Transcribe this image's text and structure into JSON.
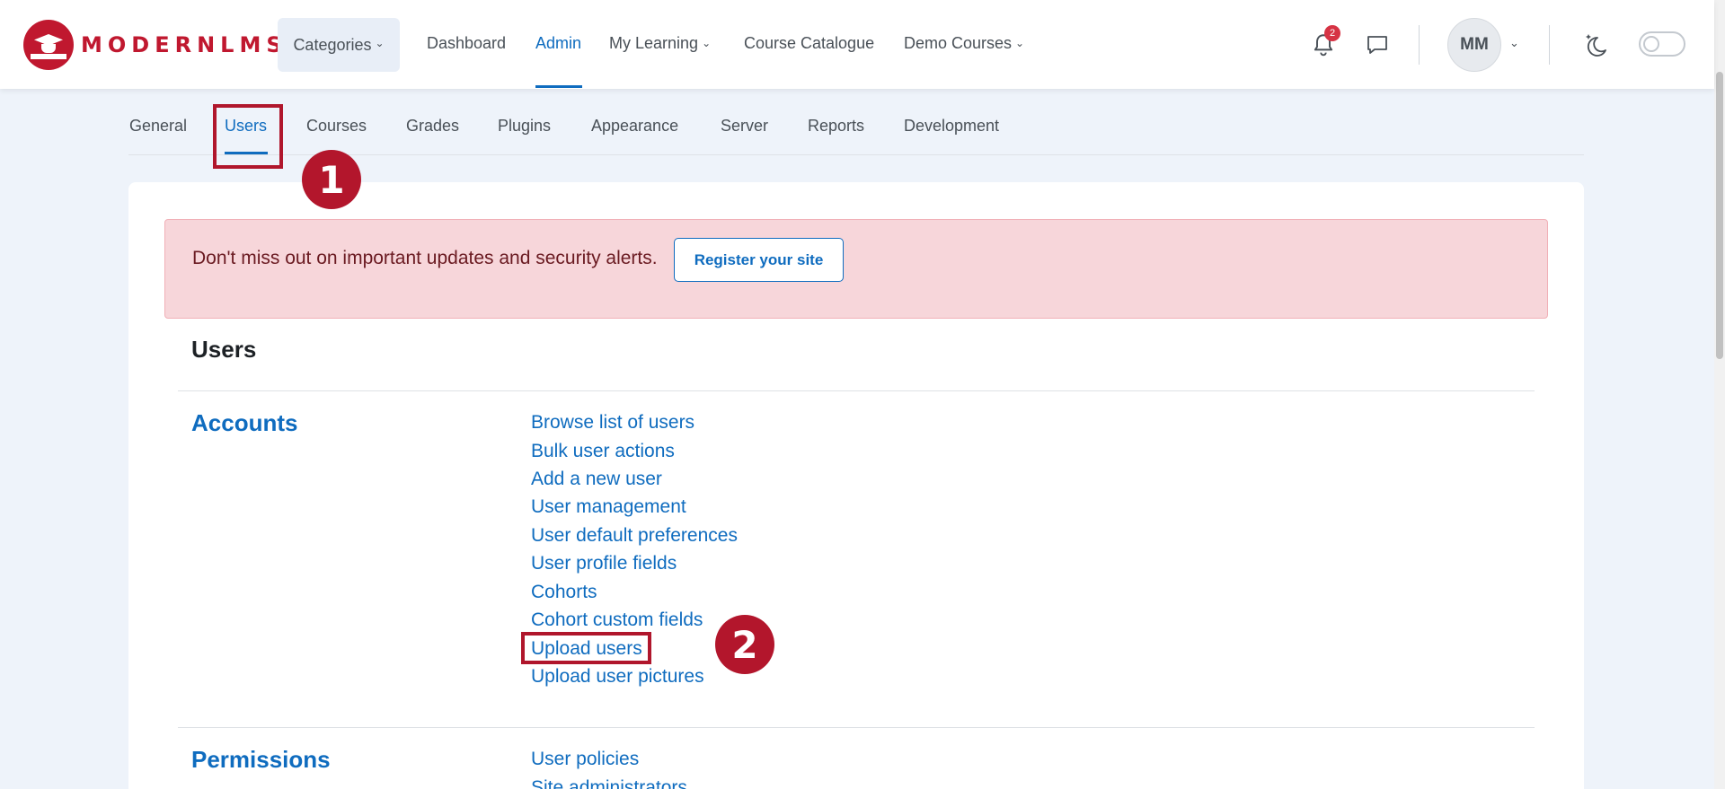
{
  "brand": {
    "logo_text": "MODERNLMS"
  },
  "navbar": {
    "items": [
      {
        "label": "Categories"
      },
      {
        "label": "Dashboard"
      },
      {
        "label": "Admin"
      },
      {
        "label": "My Learning"
      },
      {
        "label": "Course Catalogue"
      },
      {
        "label": "Demo Courses"
      }
    ],
    "active": "Admin",
    "notification_count": "2",
    "user_initials": "MM"
  },
  "admin_tabs": {
    "items": [
      "General",
      "Users",
      "Courses",
      "Grades",
      "Plugins",
      "Appearance",
      "Server",
      "Reports",
      "Development"
    ],
    "active": "Users"
  },
  "alert": {
    "message": "Don't miss out on important updates and security alerts.",
    "button_label": "Register your site"
  },
  "page": {
    "section_title": "Users",
    "categories": [
      {
        "title": "Accounts",
        "links": [
          "Browse list of users",
          "Bulk user actions",
          "Add a new user",
          "User management",
          "User default preferences",
          "User profile fields",
          "Cohorts",
          "Cohort custom fields",
          "Upload users",
          "Upload user pictures"
        ]
      },
      {
        "title": "Permissions",
        "links": [
          "User policies",
          "Site administrators"
        ]
      }
    ]
  },
  "annotations": {
    "marker_1": "1",
    "marker_2": "2"
  },
  "colors": {
    "brand": "#c0182f",
    "link": "#0f6cbf",
    "alert_bg": "#f7d6da",
    "marker": "#b3162c"
  }
}
